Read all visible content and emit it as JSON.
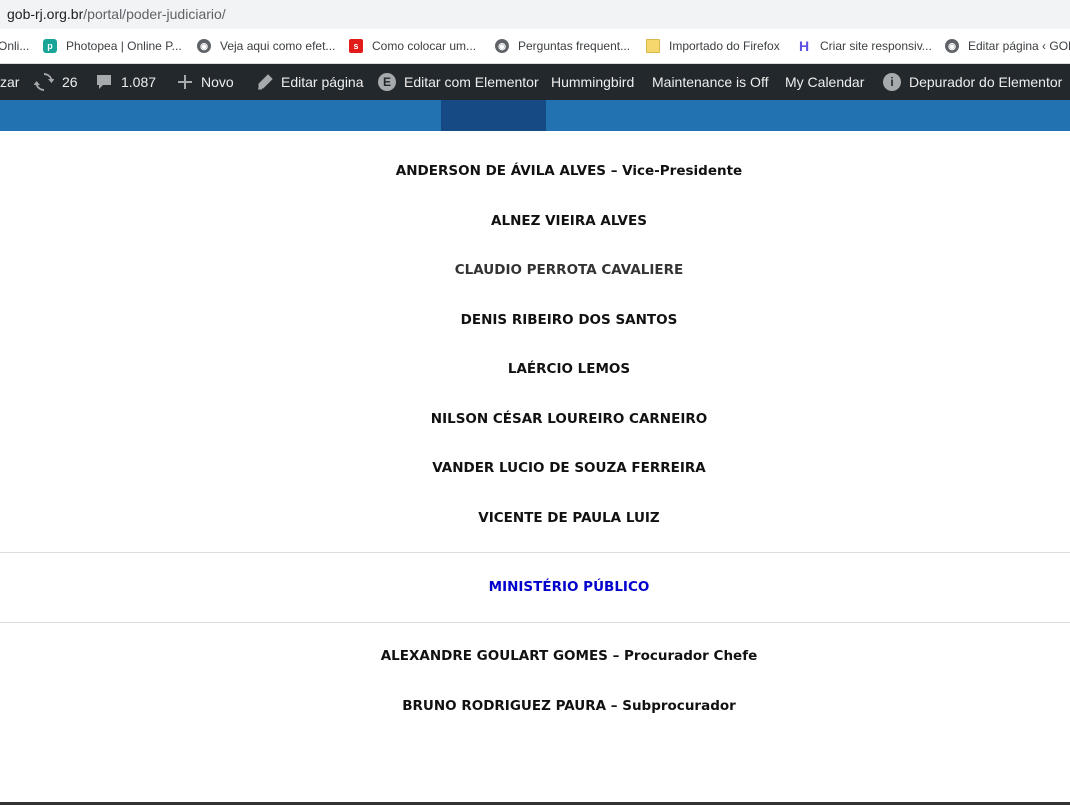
{
  "url": {
    "host": "gob-rj.org.br",
    "path": "/portal/poder-judiciario/"
  },
  "bookmarks": [
    {
      "label": "Onli...",
      "icon": "none"
    },
    {
      "label": "Photopea | Online P...",
      "icon": "photopea-icon"
    },
    {
      "label": "Veja aqui como efet...",
      "icon": "globe-icon"
    },
    {
      "label": "Como colocar um...",
      "icon": "red-s-icon"
    },
    {
      "label": "Perguntas frequent...",
      "icon": "globe-icon"
    },
    {
      "label": "Importado do Firefox",
      "icon": "folder-icon"
    },
    {
      "label": "Criar site responsiv...",
      "icon": "h-logo-icon"
    },
    {
      "label": "Editar página ‹ GOB",
      "icon": "globe-icon"
    }
  ],
  "adminbar": {
    "customize": "zar",
    "updates_count": "26",
    "comments_count": "1.087",
    "new_label": "Novo",
    "edit_page": "Editar página",
    "edit_elementor": "Editar com Elementor",
    "hummingbird": "Hummingbird",
    "maintenance": "Maintenance is Off",
    "calendar": "My Calendar",
    "debugger": "Depurador do Elementor"
  },
  "judiciario_members": [
    "ANDERSON DE ÁVILA ALVES – Vice-Presidente",
    "ALNEZ VIEIRA ALVES",
    "CLAUDIO PERROTA CAVALIERE",
    "DENIS RIBEIRO DOS SANTOS",
    "LAÉRCIO LEMOS",
    "NILSON CÉSAR LOUREIRO CARNEIRO",
    "VANDER LUCIO DE SOUZA FERREIRA",
    "VICENTE DE PAULA LUIZ"
  ],
  "ministerio": {
    "title": "MINISTÉRIO PÚBLICO",
    "members": [
      "ALEXANDRE GOULART GOMES – Procurador Chefe",
      "BRUNO RODRIGUEZ PAURA – Subprocurador"
    ]
  },
  "colors": {
    "admin_bar": "#23282d",
    "site_nav": "#2271b1",
    "site_nav_active": "#154a84",
    "section_title": "#0000cc"
  }
}
